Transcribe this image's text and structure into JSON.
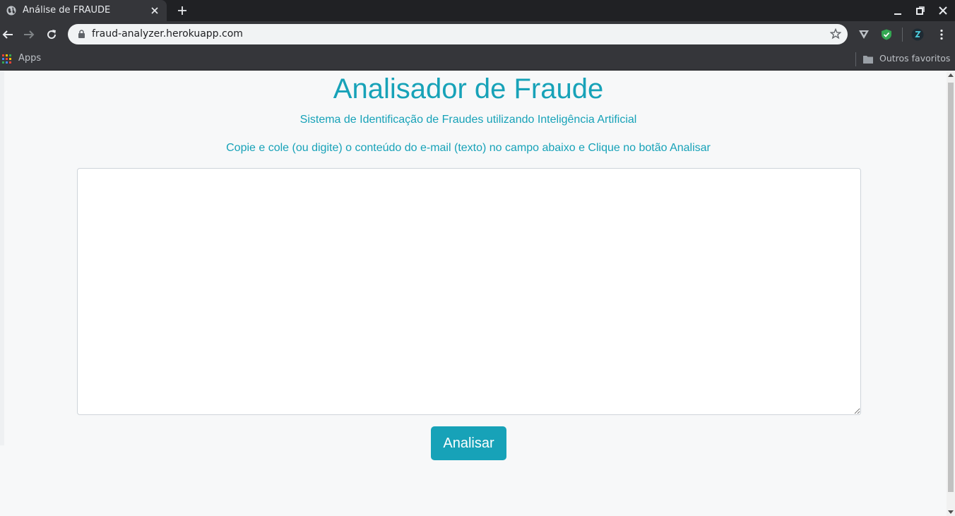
{
  "browser": {
    "tab_title": "Análise de FRAUDE",
    "url": "fraud-analyzer.herokuapp.com",
    "bookmarks": {
      "apps_label": "Apps",
      "other_label": "Outros favoritos"
    }
  },
  "page": {
    "title": "Analisador de Fraude",
    "subtitle": "Sistema de Identificação de Fraudes utilizando Inteligência Artificial",
    "instructions": "Copie e cole (ou digite) o conteúdo do e-mail (texto) no campo abaixo e Clique no botão Analisar",
    "textarea_value": "",
    "analyze_button_label": "Analisar"
  },
  "colors": {
    "accent": "#17a2b8",
    "chrome_dark": "#202124",
    "chrome_toolbar": "#35363a"
  },
  "icons": [
    "globe-icon",
    "close-icon",
    "plus-icon",
    "minimize-icon",
    "restore-icon",
    "back-icon",
    "forward-icon",
    "reload-icon",
    "lock-icon",
    "star-icon",
    "vivaldi-extension-icon",
    "shield-extension-icon",
    "profile-extension-icon",
    "more-menu-icon",
    "apps-grid-icon",
    "folder-icon"
  ]
}
